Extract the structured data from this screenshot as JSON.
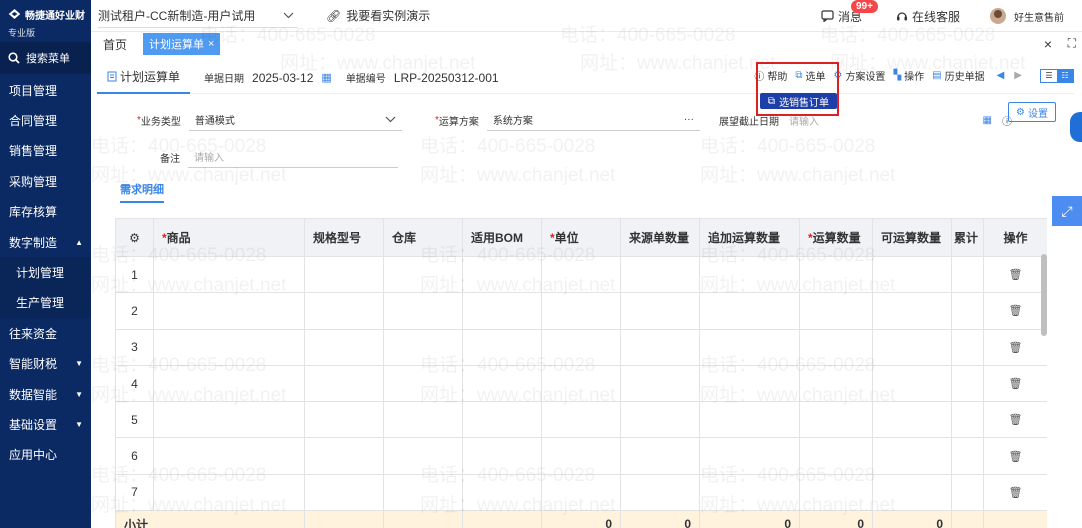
{
  "sidebar": {
    "brand_name": "畅捷通好业财",
    "brand_edition": "专业版",
    "search_label": "搜索菜单",
    "items": [
      {
        "label": "项目管理",
        "caret": ""
      },
      {
        "label": "合同管理",
        "caret": ""
      },
      {
        "label": "销售管理",
        "caret": ""
      },
      {
        "label": "采购管理",
        "caret": ""
      },
      {
        "label": "库存核算",
        "caret": ""
      },
      {
        "label": "数字制造",
        "caret": "▲"
      },
      {
        "label": "计划管理",
        "caret": ""
      },
      {
        "label": "生产管理",
        "caret": ""
      },
      {
        "label": "往来资金",
        "caret": ""
      },
      {
        "label": "智能财税",
        "caret": "▼"
      },
      {
        "label": "数据智能",
        "caret": "▼"
      },
      {
        "label": "基础设置",
        "caret": "▼"
      },
      {
        "label": "应用中心",
        "caret": ""
      }
    ]
  },
  "topbar": {
    "tenant": "测试租户-CC新制造-用户试用",
    "demo": "我要看实例演示",
    "messages": "消息",
    "message_badge": "99+",
    "service": "在线客服",
    "user": "好生意售前"
  },
  "tabs": {
    "home": "首页",
    "active": "计划运算单"
  },
  "toolbar": {
    "doc_tab": "计划运算单",
    "date_label": "单据日期",
    "date_value": "2025-03-12",
    "number_label": "单据编号",
    "number_value": "LRP-20250312-001",
    "help": "帮助",
    "select": "选单",
    "scheme_settings": "方案设置",
    "operate": "操作",
    "history": "历史单据",
    "pick_sales_order": "选销售订单"
  },
  "form": {
    "biz_type_label": "业务类型",
    "biz_type_value": "普通模式",
    "calc_scheme_label": "运算方案",
    "calc_scheme_value": "系统方案",
    "horizon_label": "展望截止日期",
    "horizon_placeholder": "请输入",
    "remark_label": "备注",
    "remark_placeholder": "请输入",
    "settings_button": "设置"
  },
  "section_tab": "需求明细",
  "table": {
    "headers": [
      "商品",
      "规格型号",
      "仓库",
      "适用BOM",
      "单位",
      "来源单数量",
      "追加运算数量",
      "运算数量",
      "可运算数量",
      "累计",
      "操作"
    ],
    "rows": [
      "1",
      "2",
      "3",
      "4",
      "5",
      "6",
      "7"
    ],
    "subtotal_label": "小计",
    "subtotals": {
      "source_qty": "0",
      "append_qty": "0",
      "calc_qty": "0",
      "avail_qty": "0",
      "cumulative": "0"
    }
  },
  "watermark": {
    "phone": "电话：400-665-0028",
    "site": "网址：www.chanjet.net"
  }
}
